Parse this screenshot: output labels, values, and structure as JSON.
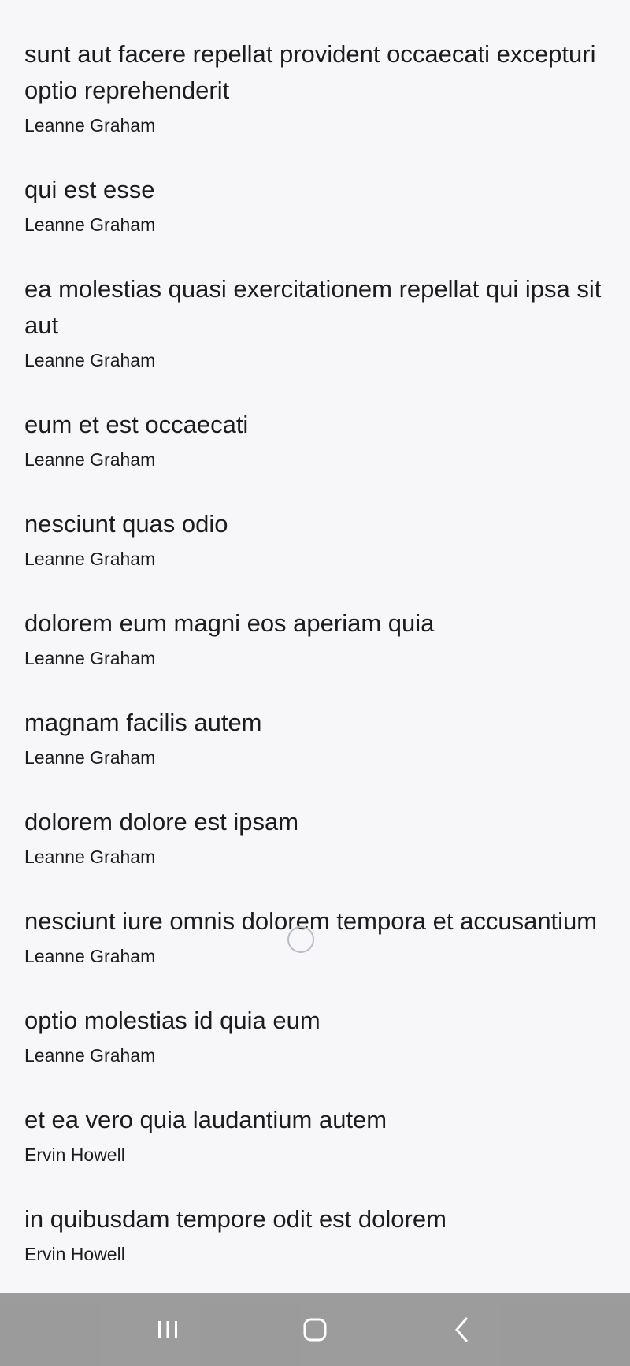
{
  "posts": [
    {
      "title": "sunt aut facere repellat provident occaecati excepturi optio reprehenderit",
      "author": "Leanne Graham"
    },
    {
      "title": "qui est esse",
      "author": "Leanne Graham"
    },
    {
      "title": "ea molestias quasi exercitationem repellat qui ipsa sit aut",
      "author": "Leanne Graham"
    },
    {
      "title": "eum et est occaecati",
      "author": "Leanne Graham"
    },
    {
      "title": "nesciunt quas odio",
      "author": "Leanne Graham"
    },
    {
      "title": "dolorem eum magni eos aperiam quia",
      "author": "Leanne Graham"
    },
    {
      "title": "magnam facilis autem",
      "author": "Leanne Graham"
    },
    {
      "title": "dolorem dolore est ipsam",
      "author": "Leanne Graham"
    },
    {
      "title": "nesciunt iure omnis dolorem tempora et accusantium",
      "author": "Leanne Graham"
    },
    {
      "title": "optio molestias id quia eum",
      "author": "Leanne Graham"
    },
    {
      "title": "et ea vero quia laudantium autem",
      "author": "Ervin Howell"
    },
    {
      "title": "in quibusdam tempore odit est dolorem",
      "author": "Ervin Howell"
    }
  ],
  "icons": {
    "recents": "recents-icon",
    "home": "home-icon",
    "back": "back-icon"
  },
  "colors": {
    "background": "#f7f7fa",
    "text": "#1c1b1f",
    "nav_bar": "#7a7a7a"
  }
}
